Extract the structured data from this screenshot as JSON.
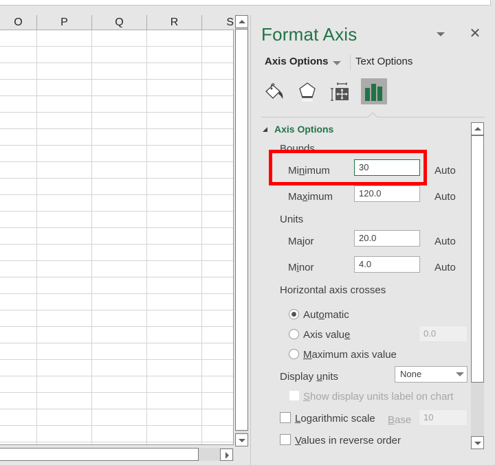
{
  "sheet": {
    "columns": [
      "O",
      "P",
      "Q",
      "R",
      "S"
    ]
  },
  "pane": {
    "title": "Format Axis",
    "close_glyph": "✕",
    "tabs": {
      "axis_options": "Axis Options",
      "text_options": "Text Options"
    },
    "icons": [
      "fill-line-icon",
      "effects-icon",
      "size-properties-icon",
      "axis-options-icon"
    ],
    "accent_color": "#217346",
    "section": {
      "title": "Axis Options",
      "bounds_label": "Bounds",
      "minimum": {
        "label_pre": "Mi",
        "label_u": "n",
        "label_post": "imum",
        "value": "30",
        "auto": "Auto"
      },
      "maximum": {
        "label_pre": "Ma",
        "label_u": "x",
        "label_post": "imum",
        "value": "120.0",
        "auto": "Auto"
      },
      "units_label": "Units",
      "major": {
        "label_pre": "Ma",
        "label_u": "j",
        "label_post": "or",
        "value": "20.0",
        "auto": "Auto"
      },
      "minor": {
        "label_pre": "M",
        "label_u": "i",
        "label_post": "nor",
        "value": "4.0",
        "auto": "Auto"
      },
      "horizontal_axis_crosses": "Horizontal axis crosses",
      "crosses_options": {
        "automatic": {
          "pre": "Aut",
          "u": "o",
          "post": "matic",
          "checked": true
        },
        "axis_value": {
          "pre": "Axis valu",
          "u": "e",
          "post": "",
          "checked": false,
          "value": "0.0"
        },
        "maximum_axis_value": {
          "pre": "",
          "u": "M",
          "post": "aximum axis value",
          "checked": false
        }
      },
      "display_units": {
        "pre": "Display ",
        "u": "u",
        "post": "nits",
        "selected": "None"
      },
      "show_display_units_label": {
        "pre": "",
        "u": "S",
        "post": "how display units label on chart",
        "checked": false
      },
      "logarithmic_scale": {
        "pre": "",
        "u": "L",
        "post": "ogarithmic scale",
        "checked": false
      },
      "base": {
        "pre": "",
        "u": "B",
        "post": "ase",
        "value": "10"
      },
      "reverse_order": {
        "pre": "",
        "u": "V",
        "post": "alues in reverse order",
        "checked": false
      }
    },
    "highlight_color": "#ff0000"
  }
}
